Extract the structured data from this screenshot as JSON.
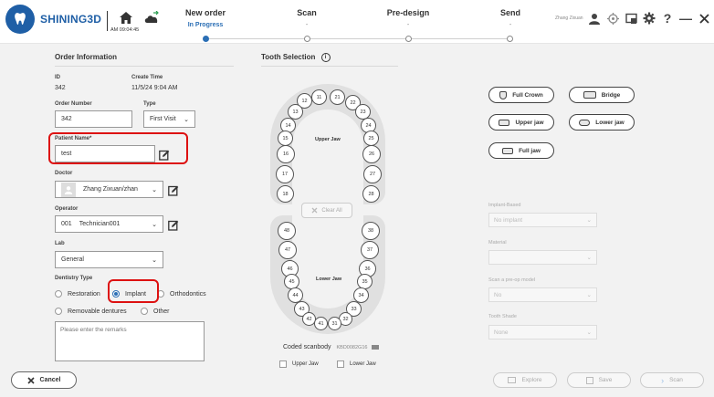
{
  "app": {
    "brand": "SHINING3D",
    "time": "AM 09:04:45"
  },
  "steps": [
    {
      "name": "New order",
      "sub": "In Progress"
    },
    {
      "name": "Scan",
      "sub": "-"
    },
    {
      "name": "Pre-design",
      "sub": "-"
    },
    {
      "name": "Send",
      "sub": "-"
    }
  ],
  "user": "Zhang Zixuan",
  "order_info": {
    "title": "Order Information",
    "id_label": "ID",
    "id_value": "342",
    "create_time_label": "Create Time",
    "create_time_value": "11/5/24 9:04 AM",
    "order_number_label": "Order Number",
    "order_number_value": "342",
    "type_label": "Type",
    "type_value": "First Visit",
    "patient_label": "Patient Name*",
    "patient_value": "test",
    "doctor_label": "Doctor",
    "doctor_value": "Zhang Zixuan/zhan",
    "operator_label": "Operator",
    "operator_code": "001",
    "operator_value": "Technician001",
    "lab_label": "Lab",
    "lab_value": "General",
    "dentistry_label": "Dentistry Type",
    "dentistry_options": [
      "Restoration",
      "Implant",
      "Orthodontics",
      "Removable dentures",
      "Other"
    ],
    "dentistry_selected": "Implant",
    "remarks_placeholder": "Please enter the remarks"
  },
  "cancel_label": "Cancel",
  "tooth_selection": {
    "title": "Tooth Selection",
    "upper_jaw_label": "Upper Jaw",
    "lower_jaw_label": "Lower Jaw",
    "clear_all": "Clear All",
    "coded_scanbody": "Coded scanbody",
    "scanbody_code": "KBD0082G16",
    "upper_jaw_check": "Upper Jaw",
    "lower_jaw_check": "Lower Jaw"
  },
  "right_panel": {
    "full_crown": "Full Crown",
    "bridge": "Bridge",
    "upper_jaw": "Upper jaw",
    "lower_jaw": "Lower jaw",
    "full_jaw": "Full jaw",
    "implant_based_label": "Implant-Based",
    "implant_based_value": "No implant",
    "material_label": "Material",
    "material_value": "",
    "preop_label": "Scan a pre-op model",
    "preop_value": "No",
    "tooth_shade_label": "Tooth Shade",
    "tooth_shade_value": "None"
  },
  "actions": {
    "explore": "Explore",
    "save": "Save",
    "scan": "Scan"
  },
  "colors": {
    "brand": "#1f5fa6",
    "accent": "#2b6fb5",
    "highlight": "#dd1111"
  }
}
